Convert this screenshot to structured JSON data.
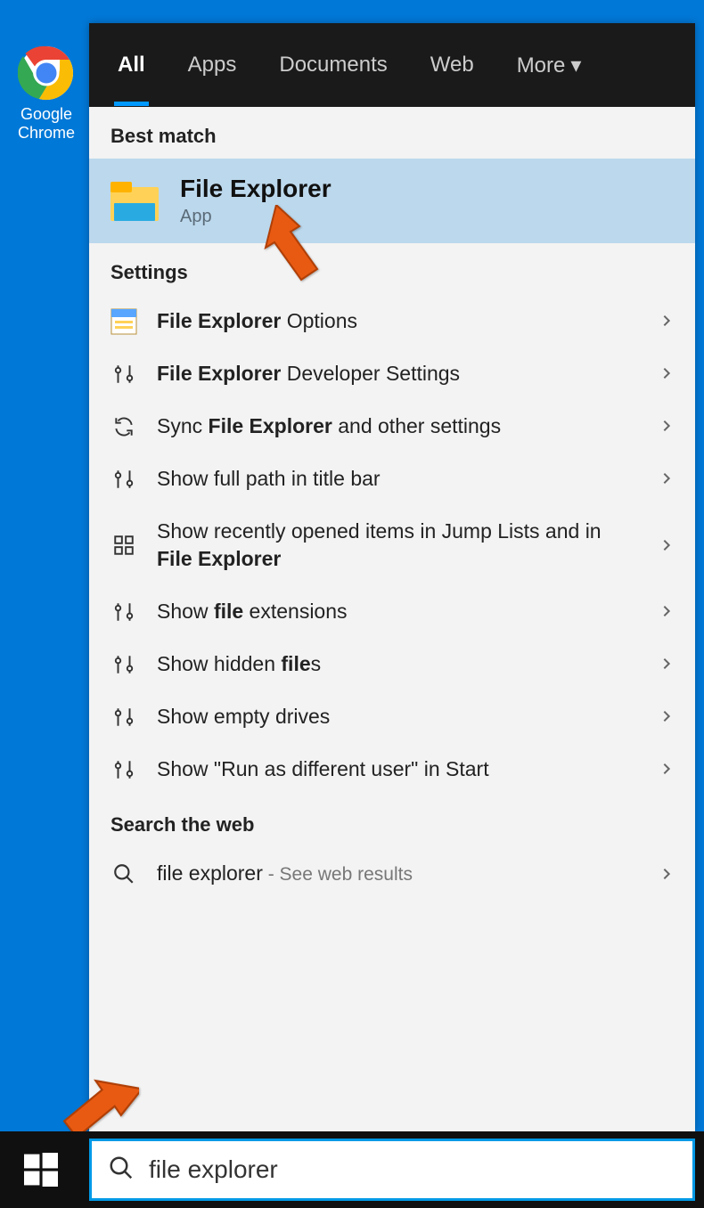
{
  "desktop": {
    "icon_label": "Google\nChrome"
  },
  "tabs": {
    "all": "All",
    "apps": "Apps",
    "documents": "Documents",
    "web": "Web",
    "more": "More"
  },
  "sections": {
    "best_match": "Best match",
    "settings": "Settings",
    "search_web": "Search the web"
  },
  "best_match": {
    "title": "File Explorer",
    "subtitle": "App"
  },
  "settings_results": [
    {
      "icon": "options",
      "html": "<b>File Explorer</b> Options"
    },
    {
      "icon": "sliders",
      "html": "<b>File Explorer</b> Developer Settings"
    },
    {
      "icon": "sync",
      "html": "Sync <b>File Explorer</b> and other settings"
    },
    {
      "icon": "sliders",
      "html": "Show full path in title bar"
    },
    {
      "icon": "grid",
      "html": "Show recently opened items in Jump Lists and in <b>File Explorer</b>"
    },
    {
      "icon": "sliders",
      "html": "Show <b>file</b> extensions"
    },
    {
      "icon": "sliders",
      "html": "Show hidden <b>file</b>s"
    },
    {
      "icon": "sliders",
      "html": "Show empty drives"
    },
    {
      "icon": "sliders",
      "html": "Show \"Run as different user\" in Start"
    }
  ],
  "web_result": {
    "main": "file explorer",
    "sub": " - See web results"
  },
  "searchbox": {
    "value": "file explorer"
  }
}
